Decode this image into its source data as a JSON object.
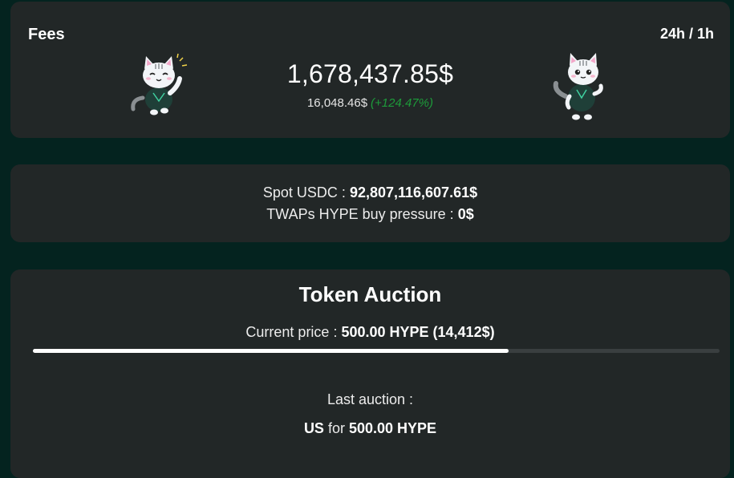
{
  "fees": {
    "title": "Fees",
    "range": "24h / 1h",
    "total": "1,678,437.85$",
    "hourly": "16,048.46$",
    "change": "(+124.47%)"
  },
  "spot": {
    "usdc_label": "Spot USDC : ",
    "usdc_value": "92,807,116,607.61$",
    "twap_label": "TWAPs HYPE buy pressure : ",
    "twap_value": "0$"
  },
  "auction": {
    "title": "Token Auction",
    "current_price_label": "Current price : ",
    "current_price_value": "500.00 HYPE (14,412$)",
    "progress_fraction": 0.693,
    "last_auction_label": "Last auction :",
    "last_auction_ticker": "US",
    "last_auction_for": " for ",
    "last_auction_price": "500.00 HYPE"
  },
  "colors": {
    "background": "#04231f",
    "card": "#222727",
    "positive": "#1d9b3a"
  },
  "icons": [
    "cat-mascot-waving-icon",
    "cat-mascot-standing-icon"
  ]
}
